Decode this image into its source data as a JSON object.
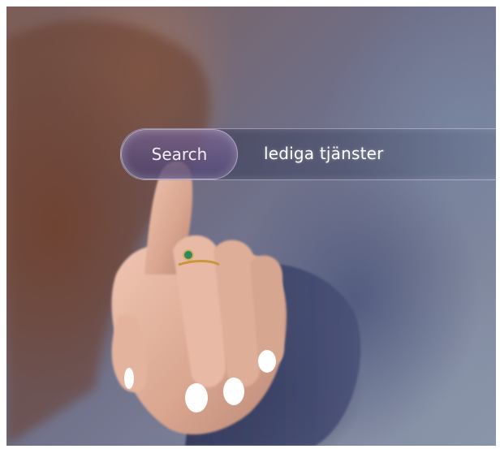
{
  "search": {
    "button_label": "Search",
    "query": "lediga tjänster"
  },
  "colors": {
    "hair": "#7a4a36",
    "skin": "#e3b39f",
    "nails": "#ffffff",
    "sleeve": "#3d4468"
  },
  "icons": [
    "ring-icon"
  ]
}
